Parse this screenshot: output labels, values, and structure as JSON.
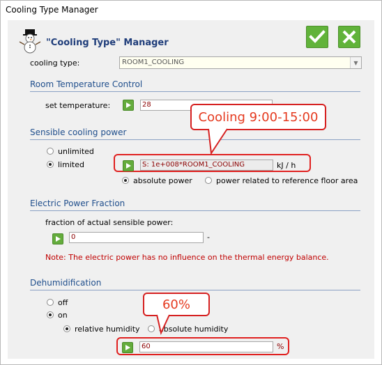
{
  "window": {
    "title": "Cooling Type Manager"
  },
  "header": {
    "title": "\"Cooling Type\" Manager"
  },
  "cooling_type": {
    "label": "cooling type:",
    "value": "ROOM1_COOLING"
  },
  "room_temp": {
    "section_title": "Room Temperature Control",
    "set_label": "set temperature:",
    "value": "28"
  },
  "sensible": {
    "section_title": "Sensible cooling power",
    "unlimited_label": "unlimited",
    "limited_label": "limited",
    "selected": "limited",
    "value": "S: 1e+008*ROOM1_COOLING",
    "unit": "kJ / h",
    "absolute_label": "absolute power",
    "related_label": "power related to reference floor area",
    "selected_mode": "absolute"
  },
  "electric": {
    "section_title": "Electric Power Fraction",
    "fraction_label": "fraction of actual sensible power:",
    "value": "0",
    "unit": "-",
    "note": "Note: The electric power has no influence on the  thermal energy balance."
  },
  "dehum": {
    "section_title": "Dehumidification",
    "off_label": "off",
    "on_label": "on",
    "selected": "on",
    "relative_label": "relative humidity",
    "absolute_label": "absolute humidity",
    "selected_mode": "relative",
    "value": "60",
    "unit": "%"
  },
  "callouts": {
    "cooling_schedule": "Cooling 9:00-15:00",
    "humidity": "60%"
  },
  "colors": {
    "accent_green": "#61b33a",
    "callout_red": "#d62020",
    "section_blue": "#1f4e8c"
  },
  "icons": [
    "snowman-icon",
    "check-icon",
    "close-icon",
    "play-icon",
    "dropdown-arrow-icon"
  ]
}
